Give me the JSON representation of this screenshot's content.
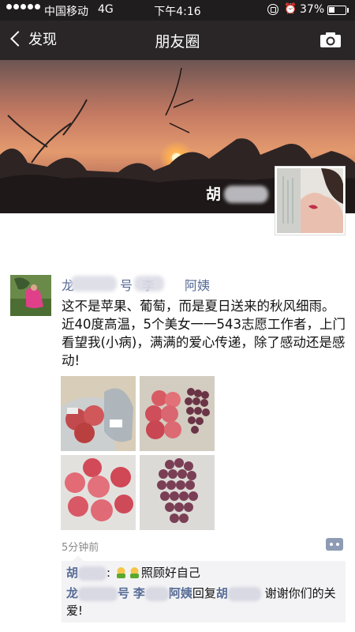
{
  "status_bar": {
    "carrier": "中国移动",
    "network": "4G",
    "time": "下午4:16",
    "battery": "37%",
    "battery_level": 0.37
  },
  "nav": {
    "back_label": "发现",
    "title": "朋友圈",
    "icons": {
      "back": "chevron-left-icon",
      "camera": "camera-icon"
    }
  },
  "cover": {
    "user_name": "胡"
  },
  "post": {
    "author_part1": "龙",
    "author_part2": "号",
    "author_part3": "李",
    "author_part4": "阿姨",
    "text": "这不是苹果、葡萄，而是夏日送来的秋风细雨。近40度高温，5个美女一一543志愿工作者，上门看望我(小病)，满满的爱心传递，除了感动还是感动!",
    "time": "5分钟前",
    "photos": [
      "apples-in-bag-photo",
      "apples-and-grapes-photo",
      "apples-photo",
      "grapes-photo"
    ],
    "comments": [
      {
        "name_part1": "胡",
        "sep": ":",
        "text": "照顾好自己"
      },
      {
        "name_part1": "龙",
        "name_part2": "号",
        "name_part3": "李",
        "name_part4": "阿姨",
        "reply_word": "回复",
        "reply_to": "胡",
        "text": "谢谢你们的关爱!"
      }
    ]
  },
  "colors": {
    "status_bg": "#1f1d1e",
    "nav_bg": "#2a2627",
    "link_blue": "#576b95",
    "comment_bg": "#f3f3f5"
  }
}
